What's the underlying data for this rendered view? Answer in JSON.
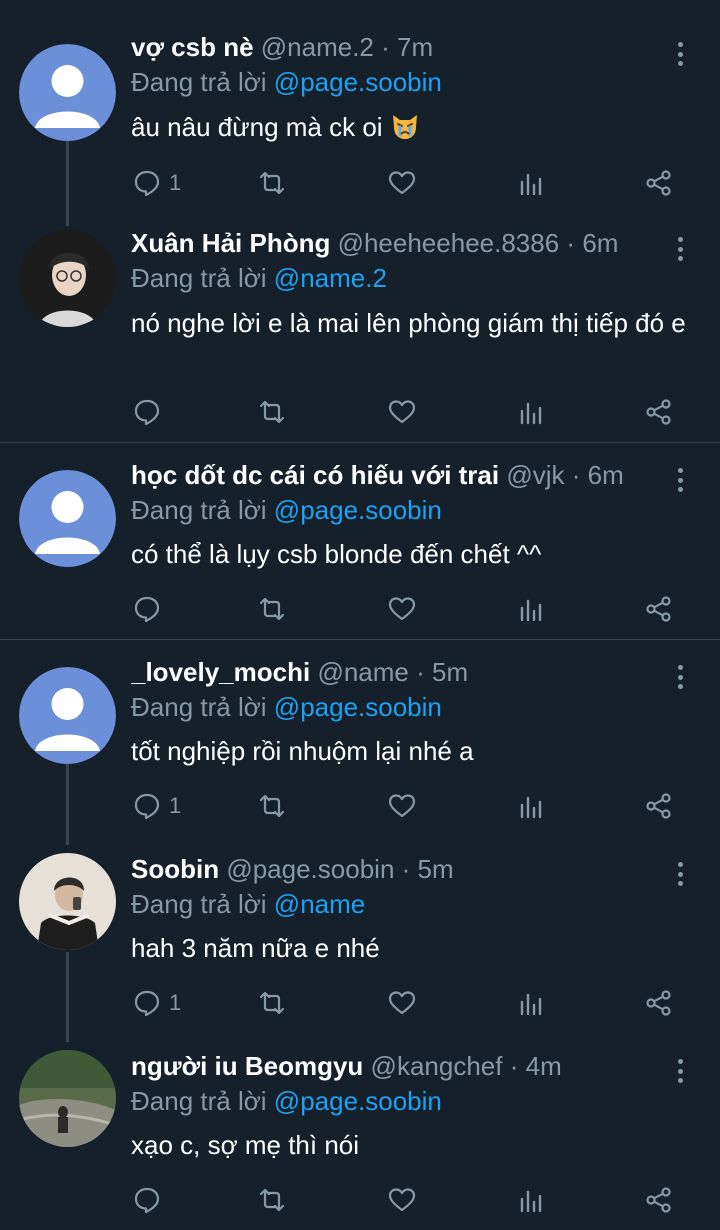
{
  "tweets": [
    {
      "name": "vợ csb nè",
      "handle": "@name.2",
      "dot": "·",
      "time": "7m",
      "replying_prefix": "Đang trả lời",
      "replying_to": "@page.soobin",
      "text": "âu nâu đừng mà ck oi",
      "emoji": "crying-cat",
      "reply_count": "1",
      "avatar": "default-avatar"
    },
    {
      "name": "Xuân Hải Phòng",
      "handle": "@heeheehee.8386",
      "dot": "·",
      "time": "6m",
      "replying_prefix": "Đang trả lời",
      "replying_to": "@name.2",
      "text": "nó nghe lời e là mai lên phòng giám thị tiếp đó e",
      "reply_count": "",
      "avatar": "photo-avatar"
    },
    {
      "name": "học dốt dc cái có hiếu với trai",
      "handle": "@vjk",
      "dot": "·",
      "time": "6m",
      "replying_prefix": "Đang trả lời",
      "replying_to": "@page.soobin",
      "text": "có thể là lụy csb blonde đến chết ^^",
      "reply_count": "",
      "avatar": "default-avatar"
    },
    {
      "name": "_lovely_mochi",
      "handle": "@name",
      "dot": "·",
      "time": "5m",
      "replying_prefix": "Đang trả lời",
      "replying_to": "@page.soobin",
      "text": "tốt nghiệp rồi nhuộm lại nhé a",
      "reply_count": "1",
      "avatar": "default-avatar"
    },
    {
      "name": "Soobin",
      "handle": "@page.soobin",
      "dot": "·",
      "time": "5m",
      "replying_prefix": "Đang trả lời",
      "replying_to": "@name",
      "text": "hah 3 năm nữa e nhé",
      "reply_count": "1",
      "avatar": "photo-avatar"
    },
    {
      "name": "người iu Beomgyu",
      "handle": "@kangchef",
      "dot": "·",
      "time": "4m",
      "replying_prefix": "Đang trả lời",
      "replying_to": "@page.soobin",
      "text": "xạo c, sợ mẹ thì nói",
      "reply_count": "",
      "avatar": "photo-avatar"
    }
  ],
  "colors": {
    "background": "#15202b",
    "muted": "#8899a6",
    "link": "#1da1f2",
    "divider": "#38444d",
    "default_avatar": "#6b8fd9"
  },
  "icons": [
    "reply-icon",
    "retweet-icon",
    "like-icon",
    "analytics-icon",
    "share-icon",
    "more-icon"
  ]
}
